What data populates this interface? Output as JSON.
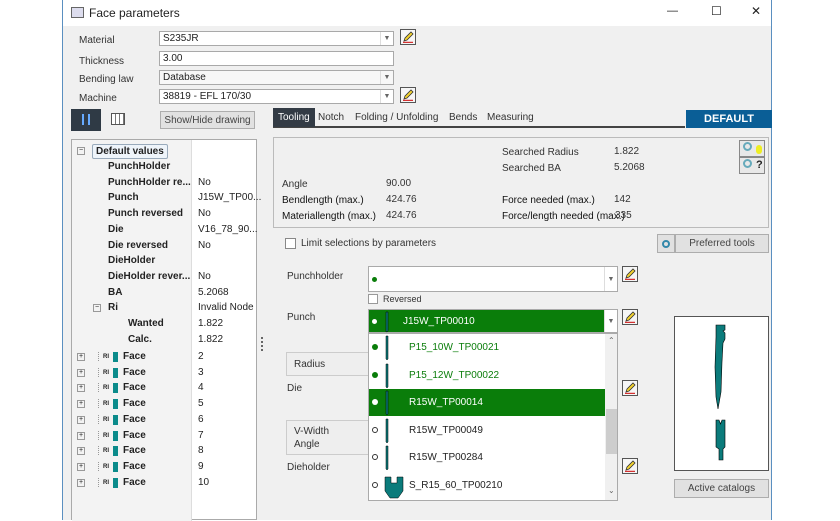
{
  "window": {
    "title": "Face parameters",
    "minimize": "—",
    "maximize": "☐",
    "close": "✕"
  },
  "form": {
    "material_label": "Material",
    "material": "S235JR",
    "thickness_label": "Thickness",
    "thickness": "3.00",
    "bending_law_label": "Bending law",
    "bending_law": "Database",
    "machine_label": "Machine",
    "machine": "38819 - EFL 170/30"
  },
  "left": {
    "show_hide": "Show/Hide drawing"
  },
  "tree": {
    "root": "Default values",
    "rows": [
      {
        "k": "PunchHolder",
        "v": ""
      },
      {
        "k": "PunchHolder re...",
        "v": "No"
      },
      {
        "k": "Punch",
        "v": "J15W_TP00..."
      },
      {
        "k": "Punch reversed",
        "v": "No"
      },
      {
        "k": "Die",
        "v": "V16_78_90..."
      },
      {
        "k": "Die reversed",
        "v": "No"
      },
      {
        "k": "DieHolder",
        "v": ""
      },
      {
        "k": "DieHolder rever...",
        "v": "No"
      },
      {
        "k": "BA",
        "v": "5.2068"
      },
      {
        "k": "Ri",
        "v": "Invalid Node"
      },
      {
        "k": "Wanted",
        "v": "1.822"
      },
      {
        "k": "Calc.",
        "v": "1.822"
      }
    ],
    "face_label": "Face",
    "faces": [
      "2",
      "3",
      "4",
      "5",
      "6",
      "7",
      "8",
      "9",
      "10"
    ],
    "ri_badge": "RI"
  },
  "tabs": [
    "Tooling",
    "Notch",
    "Folding / Unfolding",
    "Bends",
    "Measuring"
  ],
  "active_tab": "Tooling",
  "badge": "DEFAULT",
  "info": {
    "searched_radius_label": "Searched Radius",
    "searched_radius": "1.822",
    "searched_ba_label": "Searched BA",
    "searched_ba": "5.2068",
    "angle_label": "Angle",
    "angle": "90.00",
    "bendlength_label": "Bendlength (max.)",
    "bendlength": "424.76",
    "materiallength_label": "Materiallength (max.)",
    "materiallength": "424.76",
    "force_label": "Force needed (max.)",
    "force": "142",
    "force_length_label": "Force/length needed (max.)",
    "force_length": "335"
  },
  "limit_label": "Limit selections by parameters",
  "preferred_tools": "Preferred tools",
  "tooling": {
    "punchholder_label": "Punchholder",
    "reversed_label": "Reversed",
    "punch_label": "Punch",
    "punch_selected": "J15W_TP00010",
    "radius_label": "Radius",
    "die_label": "Die",
    "vwidth_label": "V-Width",
    "angle_label": "Angle",
    "dieholder_label": "Dieholder"
  },
  "punch_options": [
    {
      "name": "P15_10W_TP00021",
      "state": "available"
    },
    {
      "name": "P15_12W_TP00022",
      "state": "available"
    },
    {
      "name": "R15W_TP00014",
      "state": "highlighted"
    },
    {
      "name": "R15W_TP00049",
      "state": "unavailable"
    },
    {
      "name": "R15W_TP00284",
      "state": "unavailable"
    },
    {
      "name": "S_R15_60_TP00210",
      "state": "unavailable"
    }
  ],
  "active_catalogs": "Active catalogs",
  "colors": {
    "green": "#0a7d0a",
    "teal": "#0b7b7b",
    "accent": "#0a5e96"
  }
}
